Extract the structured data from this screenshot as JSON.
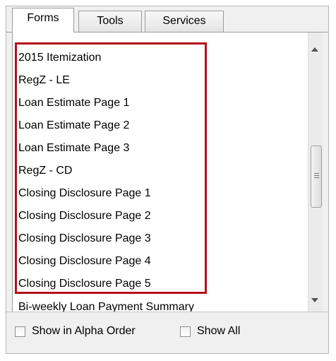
{
  "tabs": [
    "Forms",
    "Tools",
    "Services"
  ],
  "active_tab": "Forms",
  "forms": [
    "2015 Itemization",
    "RegZ - LE",
    "Loan Estimate Page 1",
    "Loan Estimate Page 2",
    "Loan Estimate Page 3",
    "RegZ - CD",
    "Closing Disclosure Page 1",
    "Closing Disclosure Page 2",
    "Closing Disclosure Page 3",
    "Closing Disclosure Page 4",
    "Closing Disclosure Page 5",
    "Bi-weekly Loan Payment Summary"
  ],
  "footer": {
    "alpha_order_label": "Show in Alpha Order",
    "show_all_label": "Show All"
  },
  "colors": {
    "highlight": "#b2111b"
  }
}
